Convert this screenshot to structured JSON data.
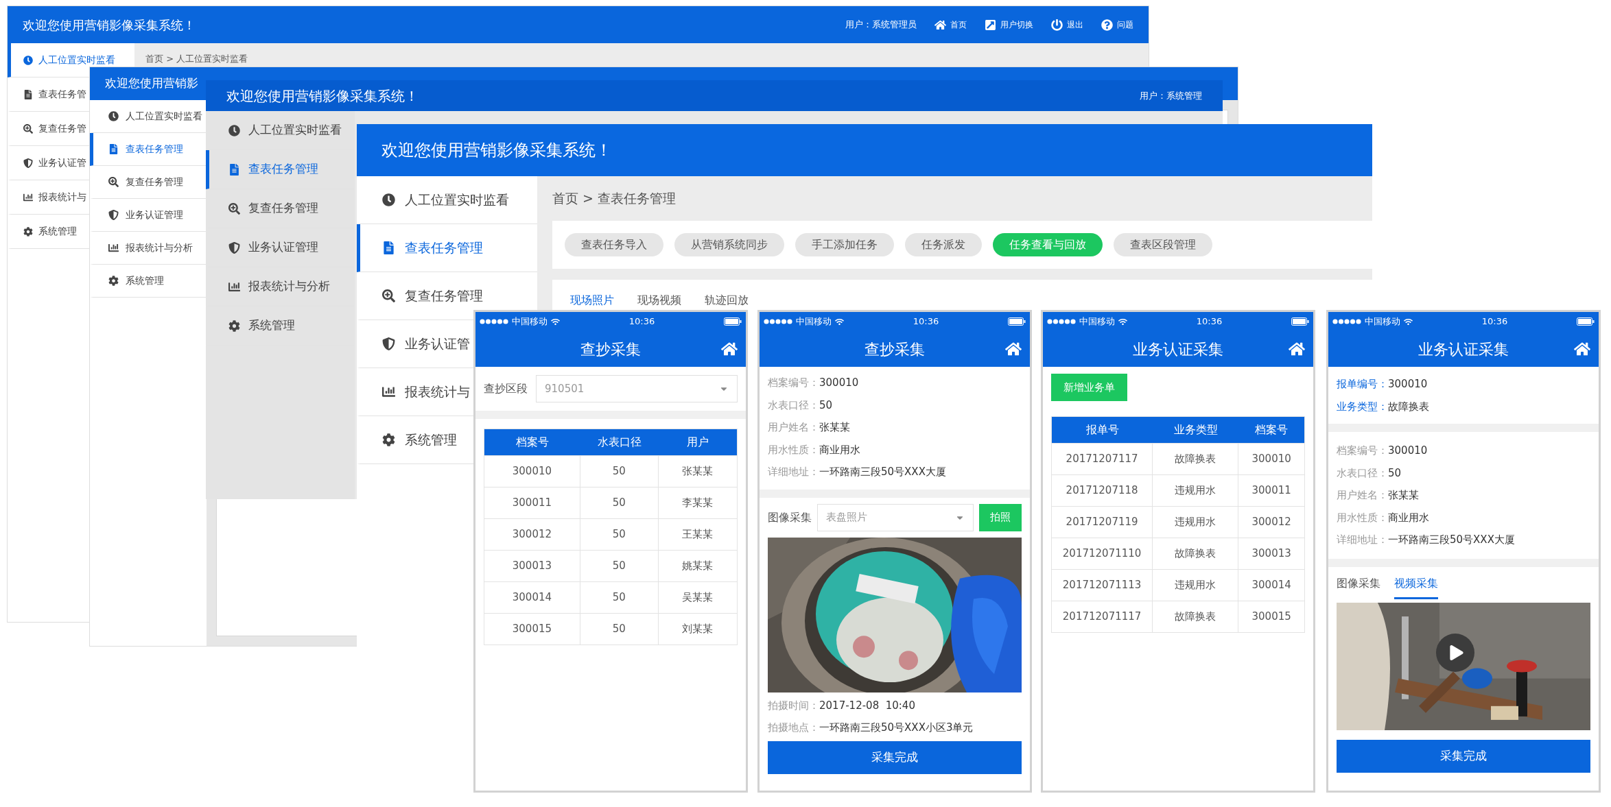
{
  "windows": [
    {
      "title": "欢迎您使用营销影像采集系统！",
      "user": "用户：系统管理员",
      "toolbar": [
        "首页",
        "用户切换",
        "退出",
        "问题"
      ],
      "breadcrumb": "首页 > 人工位置实时监看",
      "sidebar": [
        {
          "label": "人工位置实时监看",
          "selected": true
        },
        {
          "label": "查表任务管",
          "selected": false
        },
        {
          "label": "复查任务管",
          "selected": false
        },
        {
          "label": "业务认证管",
          "selected": false
        },
        {
          "label": "报表统计与",
          "selected": false
        },
        {
          "label": "系统管理",
          "selected": false
        }
      ]
    },
    {
      "title": "欢迎您使用营销影",
      "sidebar": [
        {
          "label": "人工位置实时监看",
          "selected": false
        },
        {
          "label": "查表任务管理",
          "selected": true
        },
        {
          "label": "复查任务管理",
          "selected": false
        },
        {
          "label": "业务认证管理",
          "selected": false
        },
        {
          "label": "报表统计与分析",
          "selected": false
        },
        {
          "label": "系统管理",
          "selected": false
        }
      ]
    },
    {
      "title": "欢迎您使用营销影像采集系统！",
      "user": "用户：系统管理",
      "sidebar": [
        {
          "label": "人工位置实时监看",
          "selected": false
        },
        {
          "label": "查表任务管理",
          "selected": true
        },
        {
          "label": "复查任务管理",
          "selected": false
        },
        {
          "label": "业务认证管理",
          "selected": false
        },
        {
          "label": "报表统计与分析",
          "selected": false
        },
        {
          "label": "系统管理",
          "selected": false
        }
      ]
    },
    {
      "title": "欢迎您使用营销影像采集系统！",
      "breadcrumb": "首页 > 查表任务管理",
      "sidebar": [
        {
          "label": "人工位置实时监看",
          "selected": false
        },
        {
          "label": "查表任务管理",
          "selected": true
        },
        {
          "label": "复查任务管理",
          "selected": false
        },
        {
          "label": "业务认证管",
          "selected": false
        },
        {
          "label": "报表统计与",
          "selected": false
        },
        {
          "label": "系统管理",
          "selected": false
        }
      ],
      "tabs": [
        {
          "label": "查表任务导入",
          "selected": false
        },
        {
          "label": "从营销系统同步",
          "selected": false
        },
        {
          "label": "手工添加任务",
          "selected": false
        },
        {
          "label": "任务派发",
          "selected": false
        },
        {
          "label": "任务查看与回放",
          "selected": true
        },
        {
          "label": "查表区段管理",
          "selected": false
        }
      ],
      "subtabs": [
        {
          "label": "现场照片",
          "selected": true
        },
        {
          "label": "现场视频",
          "selected": false
        },
        {
          "label": "轨迹回放",
          "selected": false
        }
      ]
    }
  ],
  "phones": [
    {
      "kind": "segment-table",
      "carrier": "中国移动",
      "time": "10:36",
      "title": "查抄采集",
      "filter": {
        "label": "查抄区段",
        "value": "910501"
      },
      "table": {
        "columns": [
          "档案号",
          "水表口径",
          "用户"
        ],
        "rows": [
          [
            "300010",
            "50",
            "张某某"
          ],
          [
            "300011",
            "50",
            "李某某"
          ],
          [
            "300012",
            "50",
            "王某某"
          ],
          [
            "300013",
            "50",
            "姚某某"
          ],
          [
            "300014",
            "50",
            "吴某某"
          ],
          [
            "300015",
            "50",
            "刘某某"
          ]
        ]
      }
    },
    {
      "kind": "meter-capture",
      "carrier": "中国移动",
      "time": "10:36",
      "title": "查抄采集",
      "fields": [
        {
          "label": "档案编号：",
          "value": "300010"
        },
        {
          "label": "水表口径：",
          "value": "50"
        },
        {
          "label": "用户姓名：",
          "value": "张某某"
        },
        {
          "label": "用水性质：",
          "value": "商业用水"
        },
        {
          "label": "详细地址：",
          "value": "一环路南三段50号XXX大厦"
        }
      ],
      "capture": {
        "label": "图像采集",
        "value": "表盘照片",
        "button": "拍照"
      },
      "meta": [
        {
          "label": "拍摄时间：",
          "value": "2017-12-08  10:40"
        },
        {
          "label": "拍摄地点：",
          "value": "一环路南三段50号XXX小区3单元"
        }
      ],
      "button": "采集完成"
    },
    {
      "kind": "order-table",
      "carrier": "中国移动",
      "time": "10:36",
      "title": "业务认证采集",
      "add_button": "新增业务单",
      "table": {
        "columns": [
          "报单号",
          "业务类型",
          "档案号"
        ],
        "rows": [
          [
            "20171207117",
            "故障换表",
            "300010"
          ],
          [
            "20171207118",
            "违规用水",
            "300011"
          ],
          [
            "20171207119",
            "违规用水",
            "300012"
          ],
          [
            "201712071110",
            "故障换表",
            "300013"
          ],
          [
            "201712071113",
            "违规用水",
            "300014"
          ],
          [
            "201712071117",
            "故障换表",
            "300015"
          ]
        ]
      }
    },
    {
      "kind": "order-capture",
      "carrier": "中国移动",
      "time": "10:36",
      "title": "业务认证采集",
      "order": [
        {
          "label": "报单编号：",
          "value": "300010"
        },
        {
          "label": "业务类型：",
          "value": "故障换表"
        }
      ],
      "fields": [
        {
          "label": "档案编号：",
          "value": "300010"
        },
        {
          "label": "水表口径：",
          "value": "50"
        },
        {
          "label": "用户姓名：",
          "value": "张某某"
        },
        {
          "label": "用水性质：",
          "value": "商业用水"
        },
        {
          "label": "详细地址：",
          "value": "一环路南三段50号XXX大厦"
        }
      ],
      "tabs": [
        {
          "label": "图像采集",
          "selected": false
        },
        {
          "label": "视频采集",
          "selected": true
        }
      ],
      "button": "采集完成"
    }
  ]
}
